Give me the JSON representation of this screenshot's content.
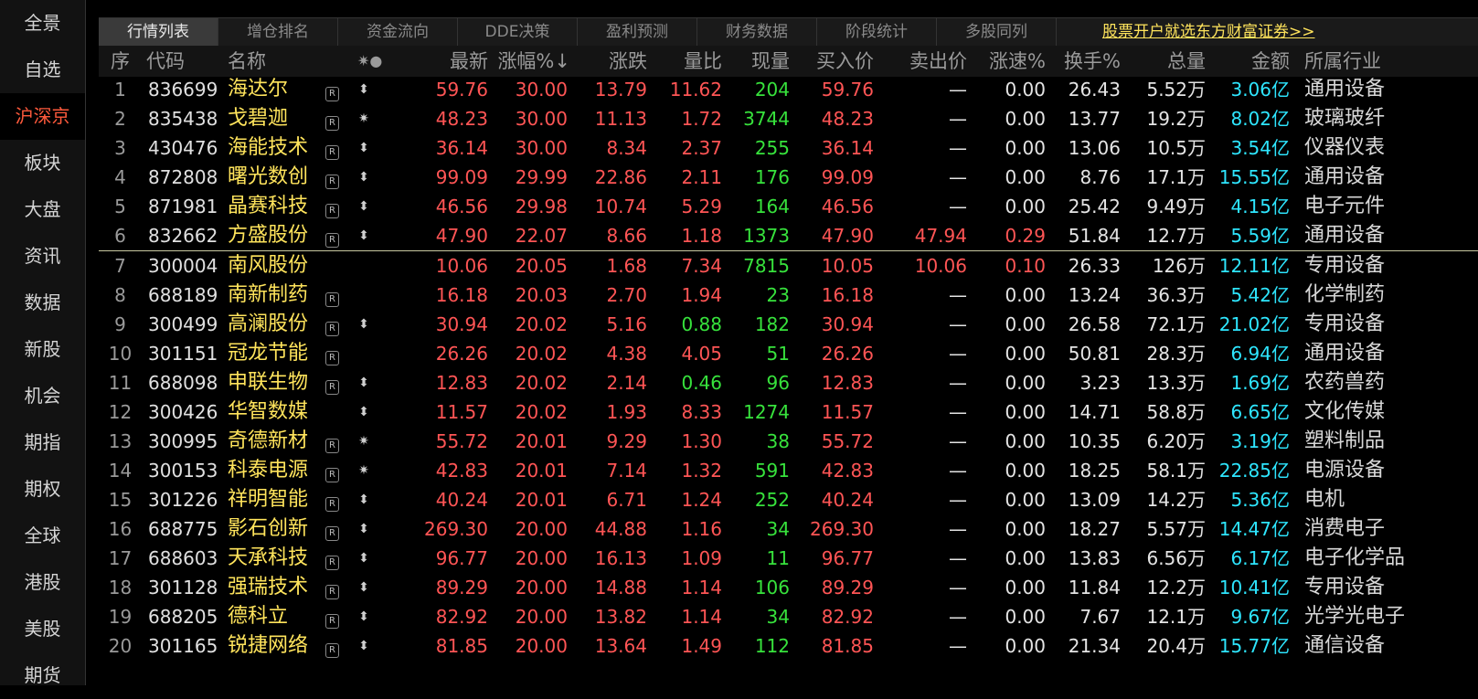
{
  "sidebar": {
    "items": [
      "全景",
      "自选",
      "沪深京",
      "板块",
      "大盘",
      "资讯",
      "数据",
      "新股",
      "机会",
      "期指",
      "期权",
      "全球",
      "港股",
      "美股",
      "期货"
    ],
    "active_index": 2
  },
  "tabs": {
    "items": [
      "行情列表",
      "增仓排名",
      "资金流向",
      "DDE决策",
      "盈利预测",
      "财务数据",
      "阶段统计",
      "多股同列"
    ],
    "active_index": 0,
    "promo": "股票开户就选东方财富证券>>"
  },
  "columns": {
    "seq": "序",
    "code": "代码",
    "name": "名称",
    "flags": "✷●",
    "latest": "最新",
    "pct": "涨幅%↓",
    "change": "涨跌",
    "volratio": "量比",
    "curvol": "现量",
    "bid": "买入价",
    "ask": "卖出价",
    "speed": "涨速%",
    "turnover": "换手%",
    "totalvol": "总量",
    "amount": "金额",
    "industry": "所属行业"
  },
  "rows": [
    {
      "seq": "1",
      "code": "836699",
      "name": "海达尔",
      "r": true,
      "mark": "⬍",
      "latest": "59.76",
      "pct": "30.00",
      "change": "13.79",
      "volratio": "11.62",
      "vr_color": "red",
      "curvol": "204",
      "bid": "59.76",
      "ask": "—",
      "speed": "0.00",
      "turnover": "26.43",
      "totalvol": "5.52万",
      "amount": "3.06亿",
      "industry": "通用设备"
    },
    {
      "seq": "2",
      "code": "835438",
      "name": "戈碧迦",
      "r": true,
      "mark": "✷",
      "latest": "48.23",
      "pct": "30.00",
      "change": "11.13",
      "volratio": "1.72",
      "vr_color": "red",
      "curvol": "3744",
      "bid": "48.23",
      "ask": "—",
      "speed": "0.00",
      "turnover": "13.77",
      "totalvol": "19.2万",
      "amount": "8.02亿",
      "industry": "玻璃玻纤"
    },
    {
      "seq": "3",
      "code": "430476",
      "name": "海能技术",
      "r": true,
      "mark": "⬍",
      "latest": "36.14",
      "pct": "30.00",
      "change": "8.34",
      "volratio": "2.37",
      "vr_color": "red",
      "curvol": "255",
      "bid": "36.14",
      "ask": "—",
      "speed": "0.00",
      "turnover": "13.06",
      "totalvol": "10.5万",
      "amount": "3.54亿",
      "industry": "仪器仪表"
    },
    {
      "seq": "4",
      "code": "872808",
      "name": "曙光数创",
      "r": true,
      "mark": "⬍",
      "latest": "99.09",
      "pct": "29.99",
      "change": "22.86",
      "volratio": "2.11",
      "vr_color": "red",
      "curvol": "176",
      "bid": "99.09",
      "ask": "—",
      "speed": "0.00",
      "turnover": "8.76",
      "totalvol": "17.1万",
      "amount": "15.55亿",
      "industry": "通用设备"
    },
    {
      "seq": "5",
      "code": "871981",
      "name": "晶赛科技",
      "r": true,
      "mark": "⬍",
      "latest": "46.56",
      "pct": "29.98",
      "change": "10.74",
      "volratio": "5.29",
      "vr_color": "red",
      "curvol": "164",
      "bid": "46.56",
      "ask": "—",
      "speed": "0.00",
      "turnover": "25.42",
      "totalvol": "9.49万",
      "amount": "4.15亿",
      "industry": "电子元件"
    },
    {
      "seq": "6",
      "code": "832662",
      "name": "方盛股份",
      "r": true,
      "mark": "⬍",
      "latest": "47.90",
      "pct": "22.07",
      "change": "8.66",
      "volratio": "1.18",
      "vr_color": "red",
      "curvol": "1373",
      "bid": "47.90",
      "ask": "47.94",
      "speed": "0.29",
      "turnover": "51.84",
      "totalvol": "12.7万",
      "amount": "5.59亿",
      "industry": "通用设备"
    },
    {
      "seq": "7",
      "code": "300004",
      "name": "南风股份",
      "r": false,
      "mark": "",
      "latest": "10.06",
      "pct": "20.05",
      "change": "1.68",
      "volratio": "7.34",
      "vr_color": "red",
      "curvol": "7815",
      "bid": "10.05",
      "ask": "10.06",
      "speed": "0.10",
      "turnover": "26.33",
      "totalvol": "126万",
      "amount": "12.11亿",
      "industry": "专用设备"
    },
    {
      "seq": "8",
      "code": "688189",
      "name": "南新制药",
      "r": true,
      "mark": "",
      "latest": "16.18",
      "pct": "20.03",
      "change": "2.70",
      "volratio": "1.94",
      "vr_color": "red",
      "curvol": "23",
      "bid": "16.18",
      "ask": "—",
      "speed": "0.00",
      "turnover": "13.24",
      "totalvol": "36.3万",
      "amount": "5.42亿",
      "industry": "化学制药"
    },
    {
      "seq": "9",
      "code": "300499",
      "name": "高澜股份",
      "r": true,
      "mark": "⬍",
      "latest": "30.94",
      "pct": "20.02",
      "change": "5.16",
      "volratio": "0.88",
      "vr_color": "green",
      "curvol": "182",
      "bid": "30.94",
      "ask": "—",
      "speed": "0.00",
      "turnover": "26.58",
      "totalvol": "72.1万",
      "amount": "21.02亿",
      "industry": "专用设备"
    },
    {
      "seq": "10",
      "code": "301151",
      "name": "冠龙节能",
      "r": true,
      "mark": "",
      "latest": "26.26",
      "pct": "20.02",
      "change": "4.38",
      "volratio": "4.05",
      "vr_color": "red",
      "curvol": "51",
      "bid": "26.26",
      "ask": "—",
      "speed": "0.00",
      "turnover": "50.81",
      "totalvol": "28.3万",
      "amount": "6.94亿",
      "industry": "通用设备"
    },
    {
      "seq": "11",
      "code": "688098",
      "name": "申联生物",
      "r": true,
      "mark": "⬍",
      "latest": "12.83",
      "pct": "20.02",
      "change": "2.14",
      "volratio": "0.46",
      "vr_color": "green",
      "curvol": "96",
      "bid": "12.83",
      "ask": "—",
      "speed": "0.00",
      "turnover": "3.23",
      "totalvol": "13.3万",
      "amount": "1.69亿",
      "industry": "农药兽药"
    },
    {
      "seq": "12",
      "code": "300426",
      "name": "华智数媒",
      "r": false,
      "mark": "⬍",
      "latest": "11.57",
      "pct": "20.02",
      "change": "1.93",
      "volratio": "8.33",
      "vr_color": "red",
      "curvol": "1274",
      "bid": "11.57",
      "ask": "—",
      "speed": "0.00",
      "turnover": "14.71",
      "totalvol": "58.8万",
      "amount": "6.65亿",
      "industry": "文化传媒"
    },
    {
      "seq": "13",
      "code": "300995",
      "name": "奇德新材",
      "r": true,
      "mark": "✷",
      "latest": "55.72",
      "pct": "20.01",
      "change": "9.29",
      "volratio": "1.30",
      "vr_color": "red",
      "curvol": "38",
      "bid": "55.72",
      "ask": "—",
      "speed": "0.00",
      "turnover": "10.35",
      "totalvol": "6.20万",
      "amount": "3.19亿",
      "industry": "塑料制品"
    },
    {
      "seq": "14",
      "code": "300153",
      "name": "科泰电源",
      "r": true,
      "mark": "✷",
      "latest": "42.83",
      "pct": "20.01",
      "change": "7.14",
      "volratio": "1.32",
      "vr_color": "red",
      "curvol": "591",
      "bid": "42.83",
      "ask": "—",
      "speed": "0.00",
      "turnover": "18.25",
      "totalvol": "58.1万",
      "amount": "22.85亿",
      "industry": "电源设备"
    },
    {
      "seq": "15",
      "code": "301226",
      "name": "祥明智能",
      "r": true,
      "mark": "⬍",
      "latest": "40.24",
      "pct": "20.01",
      "change": "6.71",
      "volratio": "1.24",
      "vr_color": "red",
      "curvol": "252",
      "bid": "40.24",
      "ask": "—",
      "speed": "0.00",
      "turnover": "13.09",
      "totalvol": "14.2万",
      "amount": "5.36亿",
      "industry": "电机"
    },
    {
      "seq": "16",
      "code": "688775",
      "name": "影石创新",
      "r": true,
      "mark": "⬍",
      "latest": "269.30",
      "pct": "20.00",
      "change": "44.88",
      "volratio": "1.16",
      "vr_color": "red",
      "curvol": "34",
      "bid": "269.30",
      "ask": "—",
      "speed": "0.00",
      "turnover": "18.27",
      "totalvol": "5.57万",
      "amount": "14.47亿",
      "industry": "消费电子"
    },
    {
      "seq": "17",
      "code": "688603",
      "name": "天承科技",
      "r": true,
      "mark": "⬍",
      "latest": "96.77",
      "pct": "20.00",
      "change": "16.13",
      "volratio": "1.09",
      "vr_color": "red",
      "curvol": "11",
      "bid": "96.77",
      "ask": "—",
      "speed": "0.00",
      "turnover": "13.83",
      "totalvol": "6.56万",
      "amount": "6.17亿",
      "industry": "电子化学品"
    },
    {
      "seq": "18",
      "code": "301128",
      "name": "强瑞技术",
      "r": true,
      "mark": "⬍",
      "latest": "89.29",
      "pct": "20.00",
      "change": "14.88",
      "volratio": "1.14",
      "vr_color": "red",
      "curvol": "106",
      "bid": "89.29",
      "ask": "—",
      "speed": "0.00",
      "turnover": "11.84",
      "totalvol": "12.2万",
      "amount": "10.41亿",
      "industry": "专用设备"
    },
    {
      "seq": "19",
      "code": "688205",
      "name": "德科立",
      "r": true,
      "mark": "⬍",
      "latest": "82.92",
      "pct": "20.00",
      "change": "13.82",
      "volratio": "1.14",
      "vr_color": "red",
      "curvol": "34",
      "bid": "82.92",
      "ask": "—",
      "speed": "0.00",
      "turnover": "7.67",
      "totalvol": "12.1万",
      "amount": "9.67亿",
      "industry": "光学光电子"
    },
    {
      "seq": "20",
      "code": "301165",
      "name": "锐捷网络",
      "r": true,
      "mark": "⬍",
      "latest": "81.85",
      "pct": "20.00",
      "change": "13.64",
      "volratio": "1.49",
      "vr_color": "red",
      "curvol": "112",
      "bid": "81.85",
      "ask": "—",
      "speed": "0.00",
      "turnover": "21.34",
      "totalvol": "20.4万",
      "amount": "15.77亿",
      "industry": "通信设备"
    }
  ],
  "colors": {
    "up_red": "#ff5555",
    "volume_green": "#37e23c",
    "amount_cyan": "#2ee6ff",
    "name_yellow": "#ffe45c",
    "active_nav": "#ff5a3c"
  }
}
